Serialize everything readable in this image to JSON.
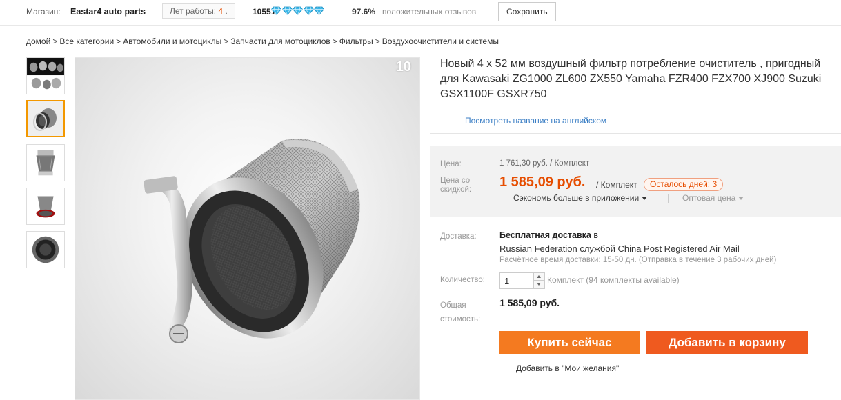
{
  "topbar": {
    "store_label": "Магазин:",
    "store_name": "Eastar4 auto parts",
    "years_label": "Лет работы:",
    "years_value": "4",
    "years_suffix": ".",
    "score": "10551",
    "diamond_count": 5,
    "diamond_color": "#3bb7e8",
    "positive_pct": "97.6%",
    "feedback_label": "положительных отзывов",
    "save_label": "Сохранить"
  },
  "breadcrumb": [
    "домой",
    "Все категории",
    "Автомобили и мотоциклы",
    "Запчасти для мотоциклов",
    "Фильтры",
    "Воздухоочистители и системы"
  ],
  "breadcrumb_separator": ">",
  "gallery": {
    "image_count": "10",
    "thumbnails": [
      "filter-set",
      "filter-with-clamp",
      "filter-front",
      "filter-side",
      "filter-inside"
    ],
    "active_thumbnail": 1
  },
  "product": {
    "title": "Новый 4 x 52 мм воздушный фильтр потребление очиститель , пригодный для Kawasaki ZG1000 ZL600 ZX550 Yamaha FZR400 FZX700 XJ900 Suzuki GSX1100F GSXR750",
    "english_link": "Посмотреть название на английском"
  },
  "price": {
    "price_label": "Цена:",
    "old_price": "1 761,30 руб. / Комплект",
    "discount_label": "Цена со скидкой:",
    "new_price": "1 585,09 руб.",
    "per_unit": "/ Комплект",
    "days_left": "Осталось дней: 3",
    "app_save": "Сэкономь больше в приложении",
    "wholesale": "Оптовая цена",
    "accent_color": "#e64d00"
  },
  "shipping": {
    "label": "Доставка:",
    "free": "Бесплатная доставка",
    "in": "в",
    "route": "Russian Federation службой China Post Registered Air Mail",
    "eta": "Расчётное время доставки: 15-50 дн. (Отправка в течение 3 рабочих дней)"
  },
  "quantity": {
    "label": "Количество:",
    "value": "1",
    "available": "Комплект (94 комплекты available)"
  },
  "total": {
    "label": "Общая стоимость:",
    "value": "1 585,09 руб."
  },
  "actions": {
    "buy_now": "Купить сейчас",
    "add_to_cart": "Добавить в корзину",
    "wishlist": "Добавить в \"Мои желания\"",
    "buy_color": "#f47a20",
    "cart_color": "#ef5a1f"
  }
}
